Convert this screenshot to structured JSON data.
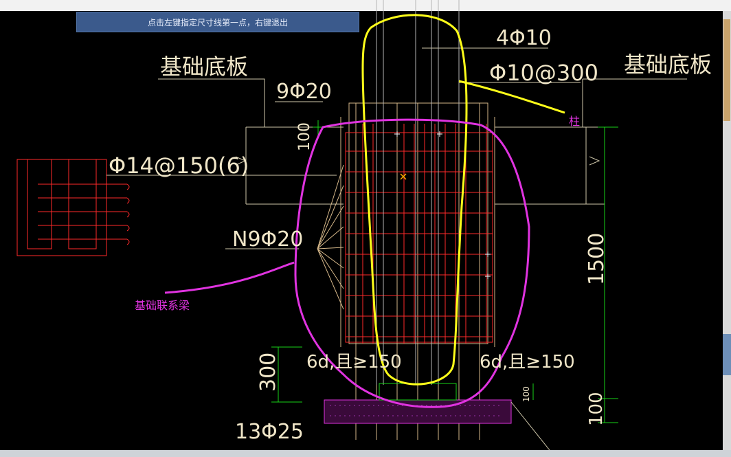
{
  "status_prompt": "点击左键指定尺寸线第一点，右键退出",
  "labels": {
    "base_slab_left": "基础底板",
    "base_slab_right": "基础底板",
    "rebar_top_column": "4Φ10",
    "stirrup_column": "Φ10@300",
    "top_bars": "9Φ20",
    "beam_stirrup": "Φ14@150(6)",
    "side_bars": "N9Φ20",
    "bottom_bars": "13Φ25",
    "anchor_left": "6d,且≥150",
    "anchor_right": "6d,且≥150",
    "dim_100_top": "100",
    "dim_1500": "1500",
    "dim_300": "300",
    "dim_100_bottom": "100",
    "dim_100_small": "100",
    "annot_column": "柱",
    "annot_beam": "基础联系梁"
  },
  "colors": {
    "background": "#000000",
    "annotation_text": "#f0e6c8",
    "rebar": "#ff2a2a",
    "dimension": "#19d419",
    "highlight_yellow": "#ffff1a",
    "highlight_magenta": "#e033e0",
    "prompt_bg": "#3b5a8c"
  }
}
